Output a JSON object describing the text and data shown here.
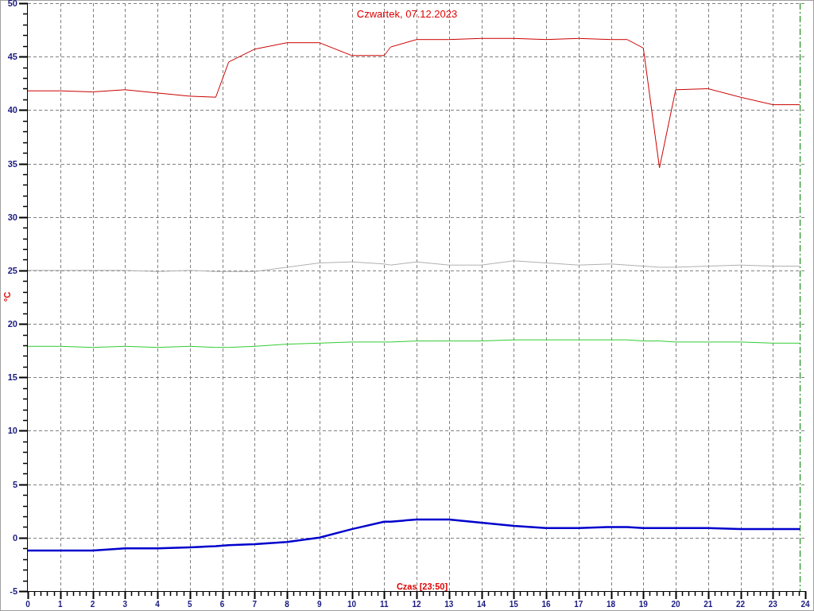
{
  "chart_data": {
    "type": "line",
    "title": "Czwartek, 07.12.2023",
    "xlabel": "Czas [23:50]",
    "ylabel": "°C",
    "x": [
      0,
      1,
      2,
      3,
      4,
      5,
      5.8,
      6.2,
      7,
      8,
      9,
      10,
      11,
      11.2,
      12,
      13,
      14,
      15,
      16,
      17,
      18,
      18.5,
      19,
      19.5,
      20,
      21,
      22,
      23,
      23.83
    ],
    "series": [
      {
        "color": "#cc0000",
        "values": [
          41.8,
          41.8,
          41.7,
          41.9,
          41.6,
          41.3,
          41.2,
          44.5,
          45.7,
          46.3,
          46.3,
          45.1,
          45.1,
          45.9,
          46.6,
          46.6,
          46.7,
          46.7,
          46.6,
          46.7,
          46.6,
          46.6,
          45.8,
          34.6,
          41.9,
          42.0,
          41.2,
          40.5,
          40.5
        ]
      },
      {
        "color": "#b0b0b0",
        "values": [
          25.0,
          25.0,
          25.0,
          25.0,
          24.9,
          25.0,
          24.9,
          24.9,
          24.9,
          25.3,
          25.7,
          25.8,
          25.6,
          25.5,
          25.8,
          25.5,
          25.5,
          25.9,
          25.7,
          25.5,
          25.6,
          25.5,
          25.4,
          25.3,
          25.3,
          25.4,
          25.5,
          25.4,
          25.4
        ]
      },
      {
        "color": "#33cc33",
        "values": [
          17.9,
          17.9,
          17.8,
          17.9,
          17.8,
          17.9,
          17.8,
          17.8,
          17.9,
          18.1,
          18.2,
          18.3,
          18.3,
          18.3,
          18.4,
          18.4,
          18.4,
          18.5,
          18.5,
          18.5,
          18.5,
          18.5,
          18.4,
          18.4,
          18.3,
          18.3,
          18.3,
          18.2,
          18.2
        ]
      },
      {
        "color": "#0000cc",
        "values": [
          -1.2,
          -1.2,
          -1.2,
          -1.0,
          -1.0,
          -0.9,
          -0.8,
          -0.7,
          -0.6,
          -0.4,
          0.0,
          0.8,
          1.5,
          1.5,
          1.7,
          1.7,
          1.4,
          1.1,
          0.9,
          0.9,
          1.0,
          1.0,
          0.9,
          0.9,
          0.9,
          0.9,
          0.8,
          0.8,
          0.8
        ]
      }
    ],
    "xlim": [
      0,
      24
    ],
    "ylim": [
      -5,
      50
    ],
    "xticks": [
      0,
      1,
      2,
      3,
      4,
      5,
      6,
      7,
      8,
      9,
      10,
      11,
      12,
      13,
      14,
      15,
      16,
      17,
      18,
      19,
      20,
      21,
      22,
      23,
      24
    ],
    "yticks": [
      -5,
      0,
      5,
      10,
      15,
      20,
      25,
      30,
      35,
      40,
      45,
      50
    ],
    "grid": true,
    "ref_lines": [
      {
        "axis": "x",
        "value": 23.83,
        "color": "#008000"
      }
    ]
  }
}
